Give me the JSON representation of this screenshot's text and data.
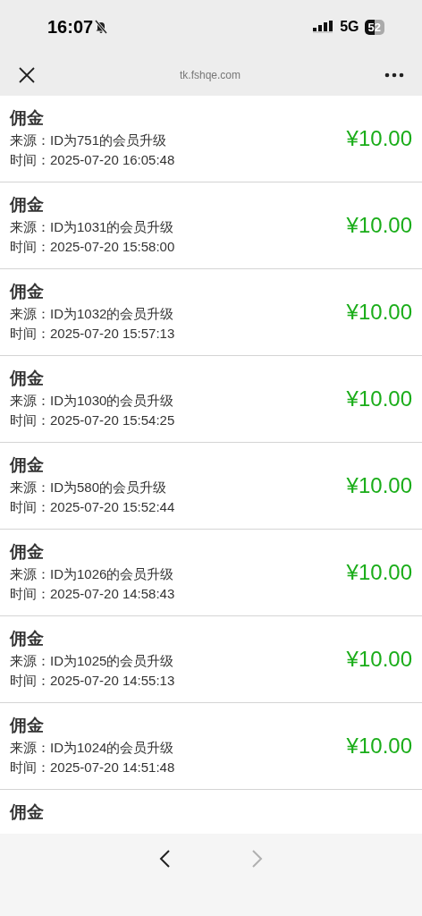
{
  "status_bar": {
    "time": "16:07",
    "network": "5G",
    "battery": "52"
  },
  "browser_bar": {
    "url": "tk.fshqe.com"
  },
  "records": [
    {
      "title": "佣金",
      "source": "来源：ID为751的会员升级",
      "time": "时间：2025-07-20 16:05:48",
      "amount": "¥10.00"
    },
    {
      "title": "佣金",
      "source": "来源：ID为1031的会员升级",
      "time": "时间：2025-07-20 15:58:00",
      "amount": "¥10.00"
    },
    {
      "title": "佣金",
      "source": "来源：ID为1032的会员升级",
      "time": "时间：2025-07-20 15:57:13",
      "amount": "¥10.00"
    },
    {
      "title": "佣金",
      "source": "来源：ID为1030的会员升级",
      "time": "时间：2025-07-20 15:54:25",
      "amount": "¥10.00"
    },
    {
      "title": "佣金",
      "source": "来源：ID为580的会员升级",
      "time": "时间：2025-07-20 15:52:44",
      "amount": "¥10.00"
    },
    {
      "title": "佣金",
      "source": "来源：ID为1026的会员升级",
      "time": "时间：2025-07-20 14:58:43",
      "amount": "¥10.00"
    },
    {
      "title": "佣金",
      "source": "来源：ID为1025的会员升级",
      "time": "时间：2025-07-20 14:55:13",
      "amount": "¥10.00"
    },
    {
      "title": "佣金",
      "source": "来源：ID为1024的会员升级",
      "time": "时间：2025-07-20 14:51:48",
      "amount": "¥10.00"
    },
    {
      "title": "佣金"
    }
  ],
  "bottom_nav": {
    "back_disabled": false,
    "forward_disabled": true
  }
}
